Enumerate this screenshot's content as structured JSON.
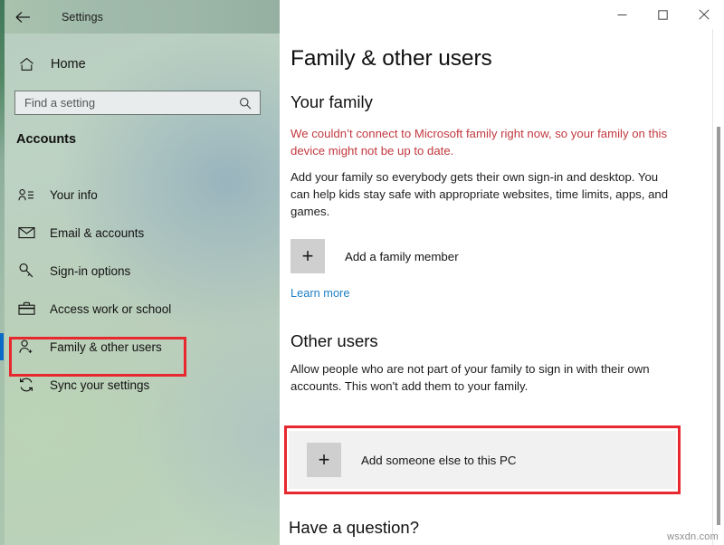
{
  "window": {
    "app_title": "Settings",
    "back_icon": "back-arrow-icon",
    "controls": {
      "minimize": "minimize-icon",
      "maximize": "maximize-icon",
      "close": "close-icon"
    }
  },
  "sidebar": {
    "home_label": "Home",
    "home_icon": "home-icon",
    "search": {
      "placeholder": "Find a setting",
      "value": "",
      "icon": "search-icon"
    },
    "category_header": "Accounts",
    "items": [
      {
        "label": "Your info",
        "icon": "your-info-icon",
        "selected": false
      },
      {
        "label": "Email & accounts",
        "icon": "envelope-icon",
        "selected": false
      },
      {
        "label": "Sign-in options",
        "icon": "key-icon",
        "selected": false
      },
      {
        "label": "Access work or school",
        "icon": "briefcase-icon",
        "selected": false
      },
      {
        "label": "Family & other users",
        "icon": "person-add-icon",
        "selected": true
      },
      {
        "label": "Sync your settings",
        "icon": "sync-icon",
        "selected": false
      }
    ]
  },
  "main": {
    "page_title": "Family & other users",
    "your_family": {
      "heading": "Your family",
      "warning": "We couldn’t connect to Microsoft family right now, so your family on this device might not be up to date.",
      "description": "Add your family so everybody gets their own sign-in and desktop. You can help kids stay safe with appropriate websites, time limits, apps, and games.",
      "add_tile_label": "Add a family member",
      "add_tile_icon": "plus-icon",
      "learn_more": "Learn more"
    },
    "other_users": {
      "heading": "Other users",
      "description": "Allow people who are not part of your family to sign in with their own accounts. This won't add them to your family.",
      "add_tile_label": "Add someone else to this PC",
      "add_tile_icon": "plus-icon"
    },
    "have_question": "Have a question?"
  },
  "annotations": {
    "highlight_color": "#e8282f",
    "selection_color": "#0b69c7",
    "link_color": "#1f7fc4",
    "warning_color": "#c2393f"
  },
  "watermark": "wsxdn.com"
}
